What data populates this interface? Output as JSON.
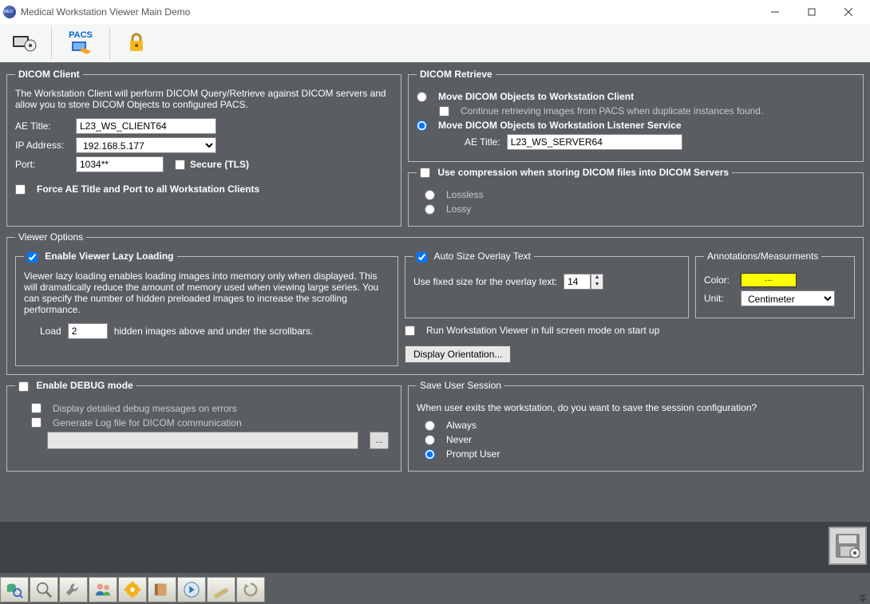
{
  "window": {
    "title": "Medical Workstation Viewer Main Demo"
  },
  "toolbar": {
    "pacs_label": "PACS"
  },
  "dicom_client": {
    "legend": "DICOM Client",
    "desc": "The Workstation Client will perform DICOM Query/Retrieve against DICOM servers and allow you to store DICOM Objects to configured PACS.",
    "ae_title_label": "AE Title:",
    "ae_title": "L23_WS_CLIENT64",
    "ip_label": "IP Address:",
    "ip": "192.168.5.177",
    "port_label": "Port:",
    "port": "1034**",
    "secure_label": "Secure (TLS)",
    "force_label": "Force AE Title and Port to all Workstation Clients"
  },
  "dicom_retrieve": {
    "legend": "DICOM Retrieve",
    "opt_client": "Move DICOM Objects to Workstation Client",
    "continue_label": "Continue retrieving images from PACS when duplicate instances found.",
    "opt_listener": "Move DICOM Objects to Workstation Listener Service",
    "ae_title_label": "AE Title:",
    "ae_title": "L23_WS_SERVER64"
  },
  "compression": {
    "legend": "Use compression when storing DICOM files into DICOM Servers",
    "lossless": "Lossless",
    "lossy": "Lossy"
  },
  "viewer_options": {
    "legend": "Viewer Options"
  },
  "lazy": {
    "legend": "Enable Viewer Lazy Loading",
    "desc": "Viewer lazy loading enables loading images into memory only when displayed. This will dramatically reduce the amount of memory used when viewing large series. You can specify the number of hidden preloaded images to increase the scrolling performance.",
    "load_label": "Load",
    "load_count": "2",
    "load_suffix": "hidden images above and under the scrollbars."
  },
  "overlay": {
    "legend": "Auto Size Overlay Text",
    "fixed_label": "Use fixed size for the overlay text:",
    "size": "14"
  },
  "annotations": {
    "legend": "Annotations/Measurments",
    "color_label": "Color:",
    "color_swatch": "...",
    "unit_label": "Unit:",
    "unit": "Centimeter"
  },
  "fullscreen_label": "Run Workstation Viewer in full screen mode on start up",
  "display_orientation_label": "Display Orientation...",
  "debug": {
    "legend": "Enable DEBUG mode",
    "detailed": "Display detailed debug messages on errors",
    "logfile": "Generate Log file for DICOM communication"
  },
  "session": {
    "legend": "Save User Session",
    "question": "When user exits the workstation, do you want to save the session configuration?",
    "always": "Always",
    "never": "Never",
    "prompt": "Prompt User"
  }
}
